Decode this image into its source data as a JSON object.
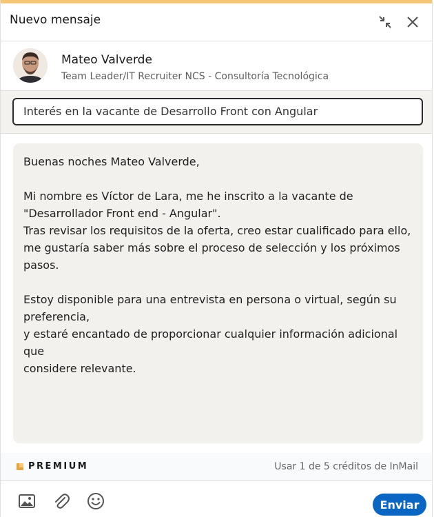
{
  "window": {
    "title": "Nuevo mensaje",
    "collapse_icon": "collapse-arrows-icon",
    "close_icon": "close-icon"
  },
  "recipient": {
    "name": "Mateo Valverde",
    "headline": "Team Leader/IT Recruiter NCS - Consultoría Tecnológica"
  },
  "subject": {
    "value": "Interés en la vacante de Desarrollo Front con Angular"
  },
  "message": {
    "lines": [
      "Buenas noches Mateo Valverde,",
      "",
      "Mi nombre es Víctor de Lara, me he inscrito a la vacante de",
      "\"Desarrollador Front end - Angular\".",
      "Tras revisar los requisitos de la oferta, creo estar cualificado para ello,",
      "me gustaría saber más sobre el proceso de selección y los próximos",
      "pasos.",
      "",
      "Estoy disponible para una entrevista en persona o virtual, según su",
      "preferencia,",
      "y estaré encantado de proporcionar cualquier información adicional que",
      "considere relevante."
    ]
  },
  "premium": {
    "label": "PREMIUM",
    "credits_text": "Usar 1 de 5 créditos de InMail"
  },
  "footer": {
    "tools": [
      "image-icon",
      "attachment-icon",
      "emoji-icon"
    ],
    "send_label": "Enviar"
  },
  "colors": {
    "accent_bar": "#f5c675",
    "send_button": "#0a66c2",
    "premium_badge": "#e7a33e"
  }
}
